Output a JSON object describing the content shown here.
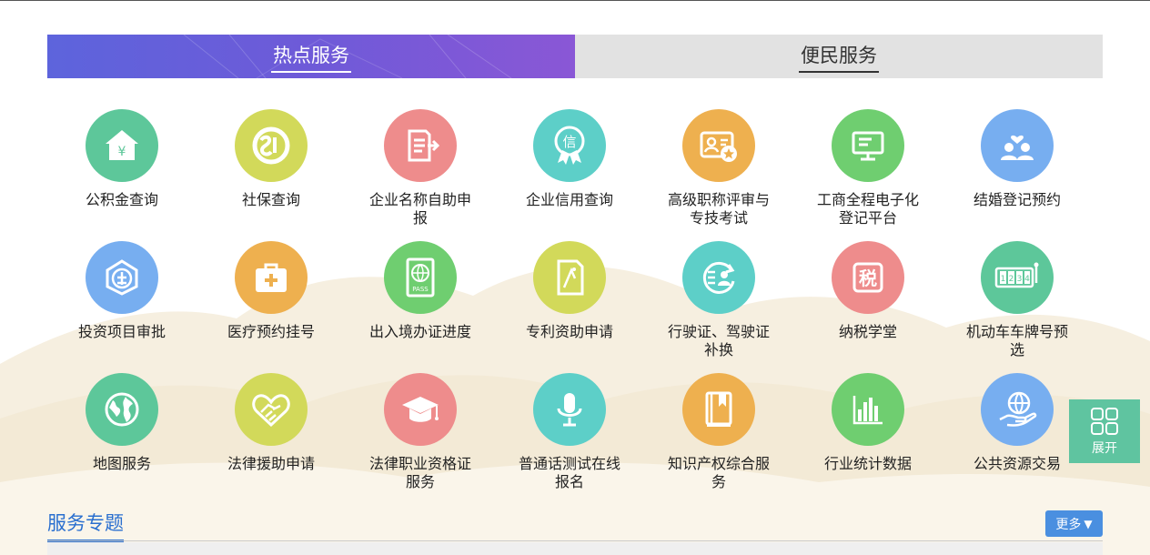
{
  "tabs": [
    {
      "label": "热点服务",
      "active": true
    },
    {
      "label": "便民服务",
      "active": false
    }
  ],
  "services": [
    {
      "label": "公积金查询",
      "color": "#5dc79a",
      "icon": "house-yen-icon"
    },
    {
      "label": "社保查询",
      "color": "#d2d95a",
      "icon": "social-security-icon"
    },
    {
      "label": "企业名称自助申报",
      "color": "#ee8c8c",
      "icon": "document-arrow-icon"
    },
    {
      "label": "企业信用查询",
      "color": "#5dcfc8",
      "icon": "credit-badge-icon"
    },
    {
      "label": "高级职称评审与专技考试",
      "color": "#eeb04f",
      "icon": "id-card-star-icon"
    },
    {
      "label": "工商全程电子化登记平台",
      "color": "#6fce70",
      "icon": "monitor-icon"
    },
    {
      "label": "结婚登记预约",
      "color": "#77aef0",
      "icon": "couple-heart-icon"
    },
    {
      "label": "投资项目审批",
      "color": "#77aef0",
      "icon": "enterprise-shield-icon"
    },
    {
      "label": "医疗预约挂号",
      "color": "#eeb04f",
      "icon": "medical-kit-icon"
    },
    {
      "label": "出入境办证进度",
      "color": "#6fce70",
      "icon": "passport-icon"
    },
    {
      "label": "专利资助申请",
      "color": "#d2d95a",
      "icon": "patent-document-icon"
    },
    {
      "label": "行驶证、驾驶证补换",
      "color": "#5dcfc8",
      "icon": "license-renew-icon"
    },
    {
      "label": "纳税学堂",
      "color": "#ee8c8c",
      "icon": "tax-icon"
    },
    {
      "label": "机动车车牌号预选",
      "color": "#5dc79a",
      "icon": "plate-number-icon"
    },
    {
      "label": "地图服务",
      "color": "#5dc79a",
      "icon": "globe-icon"
    },
    {
      "label": "法律援助申请",
      "color": "#d2d95a",
      "icon": "handshake-heart-icon"
    },
    {
      "label": "法律职业资格证服务",
      "color": "#ee8c8c",
      "icon": "graduation-cap-icon"
    },
    {
      "label": "普通话测试在线报名",
      "color": "#5dcfc8",
      "icon": "microphone-icon"
    },
    {
      "label": "知识产权综合服务",
      "color": "#eeb04f",
      "icon": "book-icon"
    },
    {
      "label": "行业统计数据",
      "color": "#6fce70",
      "icon": "bar-chart-icon"
    },
    {
      "label": "公共资源交易",
      "color": "#77aef0",
      "icon": "globe-hand-icon"
    }
  ],
  "tax_glyph": "税",
  "credit_glyph": "信",
  "yen_glyph": "¥",
  "passport_text": "PASS",
  "plate_digits": [
    "1",
    "2",
    "3",
    "4"
  ],
  "expand": {
    "label": "展开"
  },
  "section": {
    "title": "服务专题",
    "more_label": "更多"
  }
}
